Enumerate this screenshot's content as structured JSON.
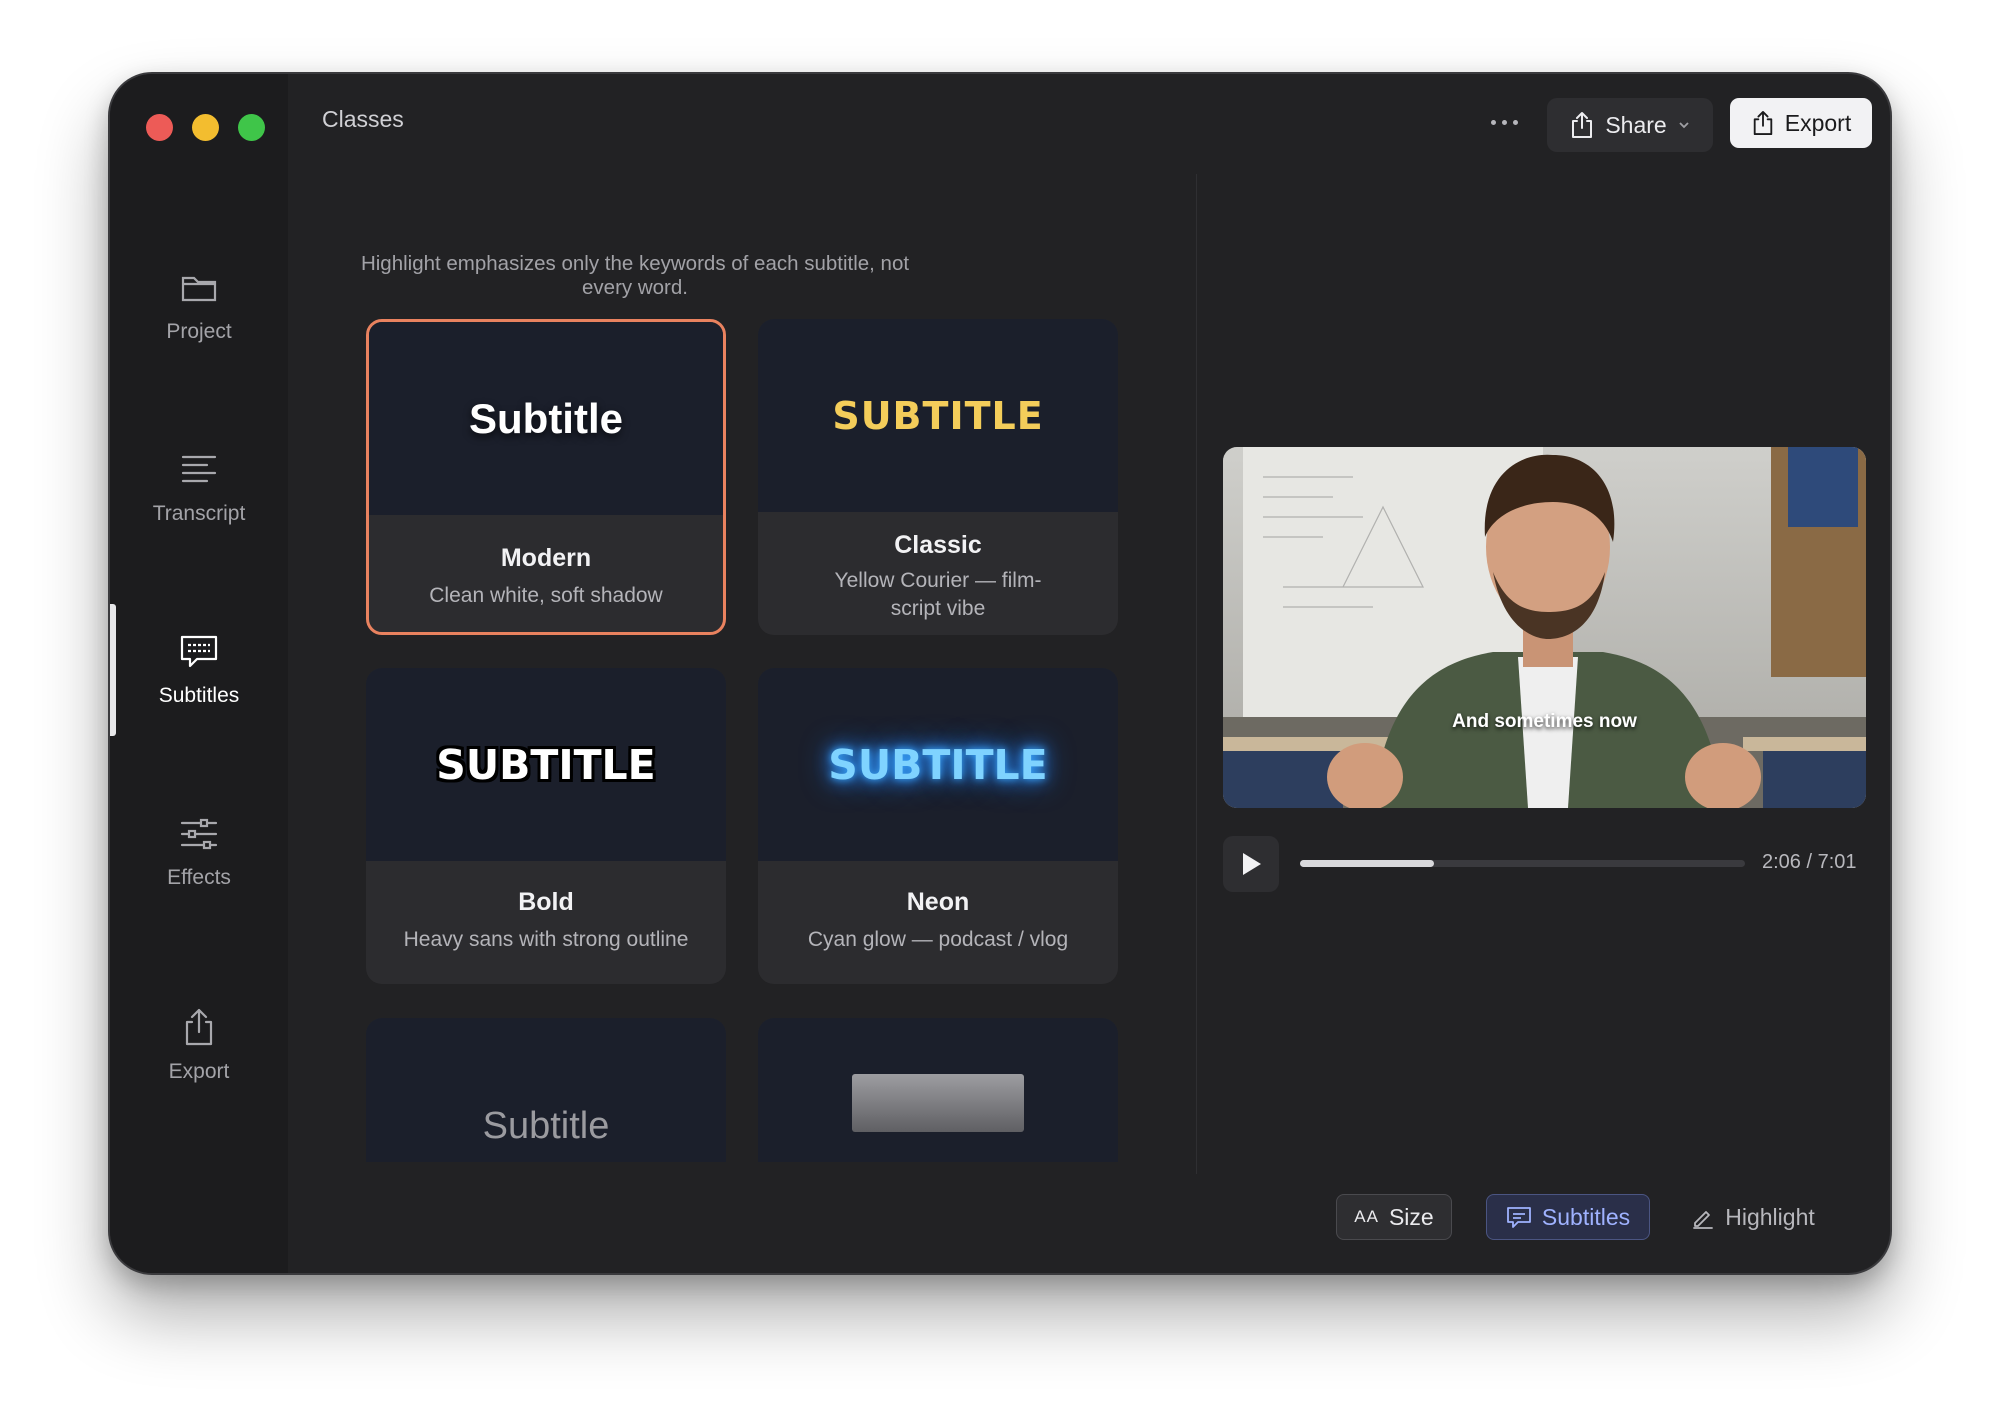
{
  "window": {
    "title": "Classes"
  },
  "header": {
    "more_icon": "ellipsis-icon",
    "share_label": "Share",
    "export_label": "Export"
  },
  "sidebar": {
    "items": [
      {
        "label": "Project",
        "icon": "folder-icon",
        "active": false
      },
      {
        "label": "Transcript",
        "icon": "lines-icon",
        "active": false
      },
      {
        "label": "Subtitles",
        "icon": "speech-bubble-icon",
        "active": true
      },
      {
        "label": "Effects",
        "icon": "sliders-icon",
        "active": false
      },
      {
        "label": "Export",
        "icon": "share-icon",
        "active": false
      }
    ]
  },
  "main": {
    "hint": "Highlight emphasizes only the keywords of each subtitle, not every word.",
    "styles": [
      {
        "preview": "Subtitle",
        "name": "Modern",
        "desc": "Clean white, soft shadow",
        "selected": true
      },
      {
        "preview": "SUBTITLE",
        "name": "Classic",
        "desc": "Yellow Courier — film-script vibe",
        "selected": false
      },
      {
        "preview": "SUBTITLE",
        "name": "Bold",
        "desc": "Heavy sans with strong outline",
        "selected": false
      },
      {
        "preview": "SUBTITLE",
        "name": "Neon",
        "desc": "Cyan glow — podcast / vlog",
        "selected": false
      },
      {
        "preview": "Subtitle",
        "name": "",
        "desc": "",
        "selected": false
      },
      {
        "preview": "",
        "name": "",
        "desc": "",
        "selected": false
      }
    ]
  },
  "player": {
    "caption": "And sometimes now",
    "progress": 0.3,
    "time": "2:06 / 7:01"
  },
  "bottom_bar": {
    "size_label": "Size",
    "size_icon_text": "AA",
    "subtitles_label": "Subtitles",
    "highlight_label": "Highlight"
  },
  "colors": {
    "accent_selected_border": "#e9825f",
    "active_tab_text": "#9fb2ff",
    "classic_yellow": "#f4cd5a",
    "neon_cyan": "#7fd3ff"
  }
}
